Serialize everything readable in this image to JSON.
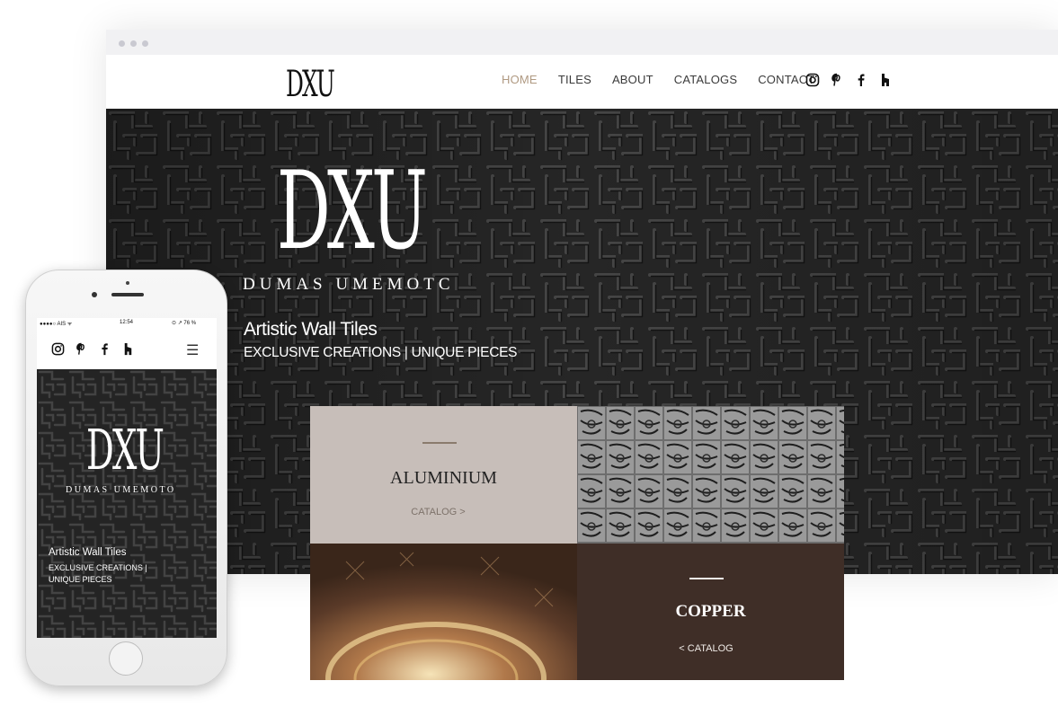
{
  "site": {
    "logo": "DXU",
    "nav": [
      {
        "label": "HOME",
        "active": true
      },
      {
        "label": "TILES",
        "active": false
      },
      {
        "label": "ABOUT",
        "active": false
      },
      {
        "label": "CATALOGS",
        "active": false
      },
      {
        "label": "CONTACT",
        "active": false
      }
    ],
    "social_icons": [
      "instagram-icon",
      "pinterest-icon",
      "facebook-icon",
      "houzz-icon"
    ]
  },
  "hero": {
    "logo": "DXU",
    "brand": "DUMAS UMEMOTC",
    "title": "Artistic Wall Tiles",
    "subtitle": "EXCLUSIVE CREATIONS | UNIQUE PIECES"
  },
  "catalogs": {
    "aluminium": {
      "title": "ALUMINIUM",
      "link": "CATALOG >"
    },
    "copper": {
      "title": "COPPER",
      "link": "< CATALOG"
    }
  },
  "mobile": {
    "status": {
      "carrier": "●●●●○ AIS ᯤ",
      "time": "12:54",
      "battery": "⊙ ↗ 76 %"
    },
    "menu_icon": "☰",
    "logo": "DXU",
    "brand": "DUMAS UMEMOTO",
    "title": "Artistic Wall Tiles",
    "subtitle_line1": "EXCLUSIVE CREATIONS |",
    "subtitle_line2": "UNIQUE PIECES"
  },
  "colors": {
    "accent": "#b09a82",
    "aluminium_bg": "#c7beb9",
    "copper_bg": "#3f2e27"
  }
}
